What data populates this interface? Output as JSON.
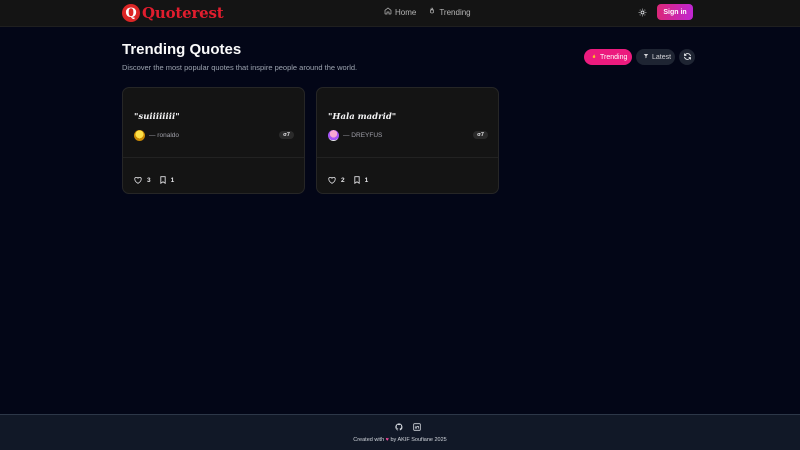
{
  "header": {
    "logo_letter": "Q",
    "logo_text": "Quoterest",
    "nav": [
      {
        "label": "Home",
        "icon": "home-icon"
      },
      {
        "label": "Trending",
        "icon": "flame-icon"
      }
    ],
    "theme_icon": "sun-icon",
    "signin_label": "Sign in",
    "colors": {
      "brand": "#e11d2e",
      "signin_gradient": [
        "#db2777",
        "#c026d3"
      ]
    }
  },
  "page": {
    "title": "Trending Quotes",
    "subtitle": "Discover the most popular quotes that inspire people around the world."
  },
  "filters": {
    "trending_label": "Trending",
    "latest_label": "Latest",
    "active": "Trending",
    "refresh_icon": "refresh-icon",
    "colors": {
      "active": "#ec1b7e",
      "inactive": "#1e2432"
    }
  },
  "quotes": [
    {
      "text": "\"suiiiiiiii\"",
      "author": "— ronaldo",
      "views": "σ7",
      "likes": "3",
      "saves": "1"
    },
    {
      "text": "\"Hala madrid\"",
      "author": "— DREYFUS",
      "views": "σ7",
      "likes": "2",
      "saves": "1"
    }
  ],
  "footer": {
    "icons": [
      "github-icon",
      "linkedin-icon"
    ],
    "credit_prefix": "Created with",
    "credit_suffix": "by AKIF Soufiane 2025"
  }
}
